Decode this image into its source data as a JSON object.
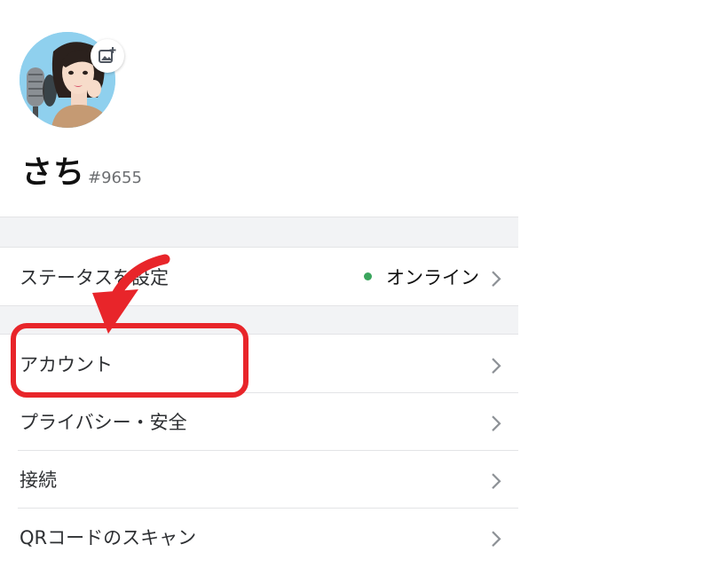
{
  "profile": {
    "username": "さち",
    "discriminator": "#9655",
    "avatar_icon": "user-avatar-illustration",
    "edit_icon": "add-image-icon"
  },
  "status_row": {
    "label": "ステータスを設定",
    "value": "オンライン",
    "status_color": "#3ba55d"
  },
  "menu": {
    "items": [
      {
        "label": "アカウント"
      },
      {
        "label": "プライバシー・安全"
      },
      {
        "label": "接続"
      },
      {
        "label": "QRコードのスキャン"
      }
    ]
  },
  "annotation": {
    "color": "#e8252a",
    "target": "アカウント"
  }
}
